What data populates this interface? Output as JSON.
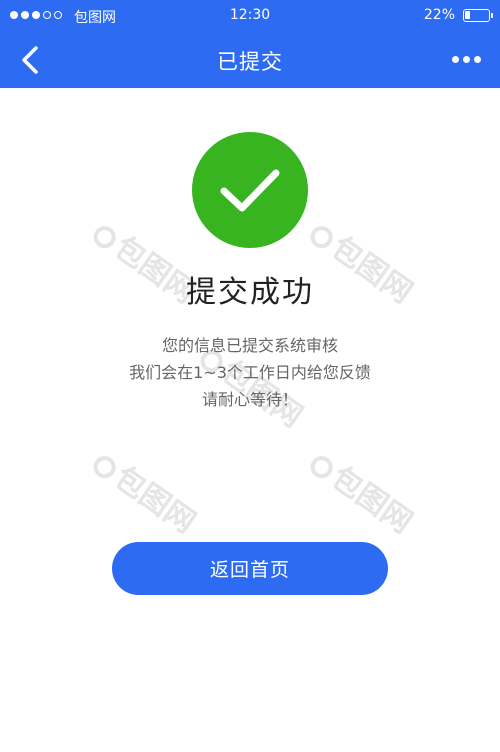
{
  "status_bar": {
    "signal_full": 3,
    "signal_total": 5,
    "carrier": "包图网",
    "time": "12:30",
    "battery_text": "22%",
    "battery_level": 0.22
  },
  "nav": {
    "back_icon": "chevron-left-icon",
    "title": "已提交",
    "more_icon": "more-dots-icon"
  },
  "result": {
    "icon": "checkmark-icon",
    "icon_color": "#37b41f",
    "title": "提交成功",
    "lines": [
      "您的信息已提交系统审核",
      "我们会在1~3个工作日内给您反馈",
      "请耐心等待！"
    ]
  },
  "actions": {
    "home_label": "返回首页"
  },
  "watermark": {
    "text": "包图网"
  },
  "colors": {
    "primary": "#2d6cf2",
    "success": "#37b41f"
  }
}
